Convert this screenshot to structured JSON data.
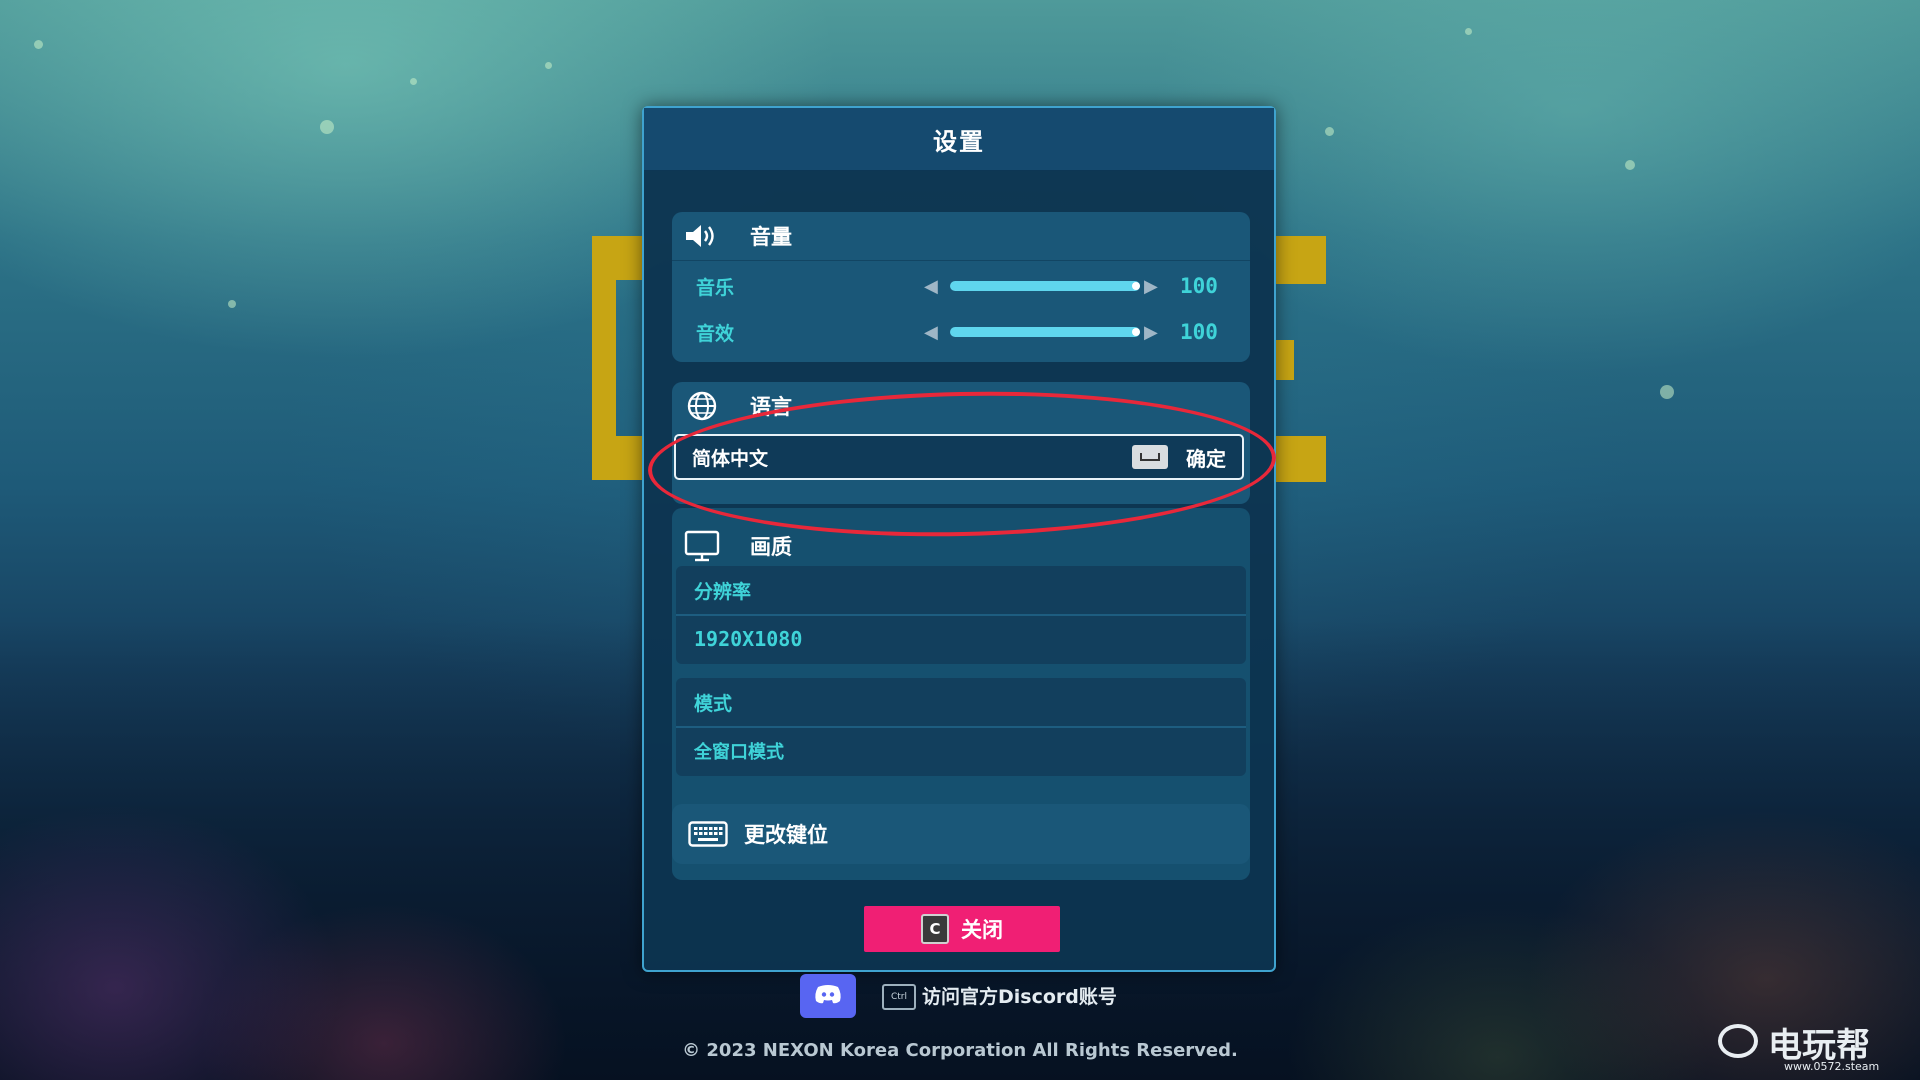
{
  "settings": {
    "title": "设置",
    "volume": {
      "header": "音量",
      "icon": "speaker-icon",
      "rows": [
        {
          "label": "音乐",
          "value": "100",
          "level": 1.0
        },
        {
          "label": "音效",
          "value": "100",
          "level": 1.0
        }
      ]
    },
    "language": {
      "header": "语言",
      "icon": "globe-icon",
      "selected": "简体中文",
      "confirm_label": "确定",
      "confirm_key_icon": "spacebar-key-icon"
    },
    "graphics": {
      "header": "画质",
      "icon": "monitor-icon",
      "resolution_label": "分辨率",
      "resolution_value": "1920X1080",
      "mode_label": "模式",
      "mode_value": "全窗口模式"
    },
    "keybinding": {
      "label": "更改键位",
      "icon": "keyboard-icon"
    },
    "close": {
      "key": "C",
      "label": "关闭"
    }
  },
  "footer": {
    "discord_icon": "discord-icon",
    "ctrl_key": "Ctrl",
    "discord_text": "访问官方Discord账号",
    "copyright": "© 2023 NEXON Korea Corporation All Rights Reserved."
  },
  "watermark": {
    "text": "电玩帮",
    "url": "www.0572.steam"
  },
  "colors": {
    "accent_cyan": "#3fd3d8",
    "close_button": "#f01f74",
    "annotation_red": "#e8283a",
    "bracket_yellow": "#c7a514"
  }
}
